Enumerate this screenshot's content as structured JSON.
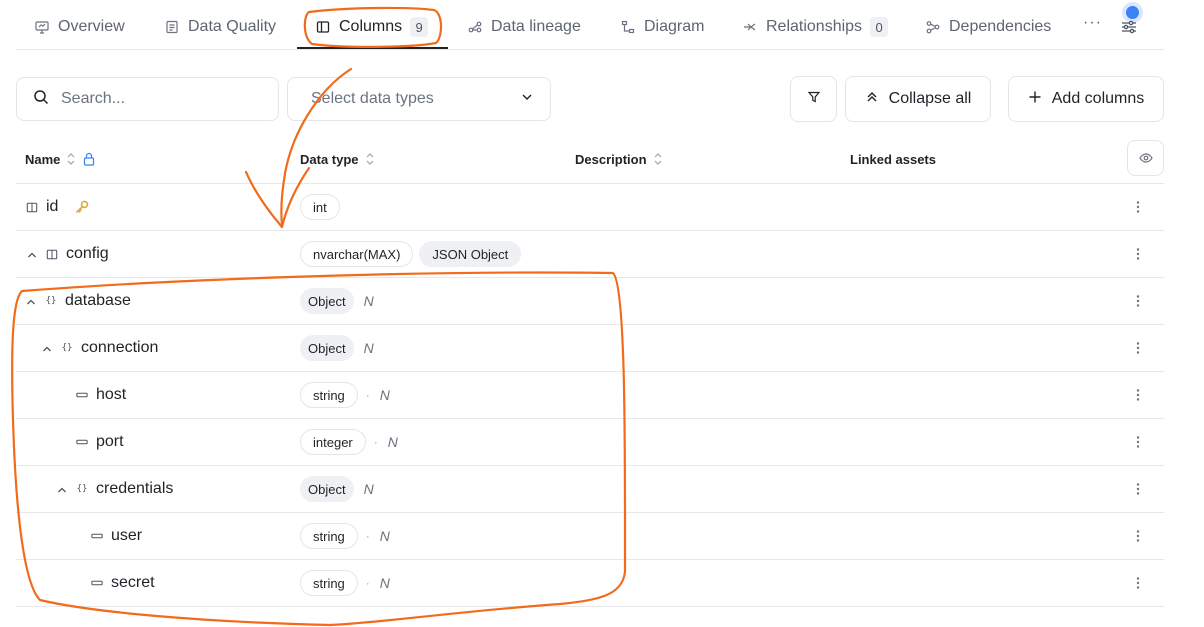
{
  "tabs": [
    {
      "label": "Overview",
      "icon": "overview-icon"
    },
    {
      "label": "Data Quality",
      "icon": "data-quality-icon"
    },
    {
      "label": "Columns",
      "icon": "columns-icon",
      "badge": "9",
      "active": true
    },
    {
      "label": "Data lineage",
      "icon": "lineage-icon"
    },
    {
      "label": "Diagram",
      "icon": "diagram-icon"
    },
    {
      "label": "Relationships",
      "icon": "relationships-icon",
      "badge": "0"
    },
    {
      "label": "Dependencies",
      "icon": "dependencies-icon"
    }
  ],
  "tab_more": "···",
  "toolbar": {
    "search_placeholder": "Search...",
    "select_placeholder": "Select data types",
    "collapse_label": "Collapse all",
    "add_label": "Add columns"
  },
  "table": {
    "headers": {
      "name": "Name",
      "data_type": "Data type",
      "description": "Description",
      "linked_assets": "Linked assets"
    },
    "rows": [
      {
        "name": "id",
        "depth": 0,
        "types": [
          "int"
        ],
        "key": true
      },
      {
        "name": "config",
        "depth": 0,
        "types": [
          "nvarchar(MAX)",
          "JSON Object"
        ],
        "expandable": true
      },
      {
        "name": "database",
        "depth": 1,
        "types": [
          "Object"
        ],
        "nullable": "N",
        "expandable": true
      },
      {
        "name": "connection",
        "depth": 2,
        "types": [
          "Object"
        ],
        "nullable": "N",
        "expandable": true
      },
      {
        "name": "host",
        "depth": 3,
        "types": [
          "string"
        ],
        "nullable": "N"
      },
      {
        "name": "port",
        "depth": 3,
        "types": [
          "integer"
        ],
        "nullable": "N"
      },
      {
        "name": "credentials",
        "depth": 3,
        "types": [
          "Object"
        ],
        "nullable": "N",
        "expandable": true
      },
      {
        "name": "user",
        "depth": 4,
        "types": [
          "string"
        ],
        "nullable": "N"
      },
      {
        "name": "secret",
        "depth": 4,
        "types": [
          "string"
        ],
        "nullable": "N"
      }
    ]
  },
  "colors": {
    "annotation": "#f26a1b",
    "accent": "#3b82f6",
    "key": "#e0a82e"
  }
}
